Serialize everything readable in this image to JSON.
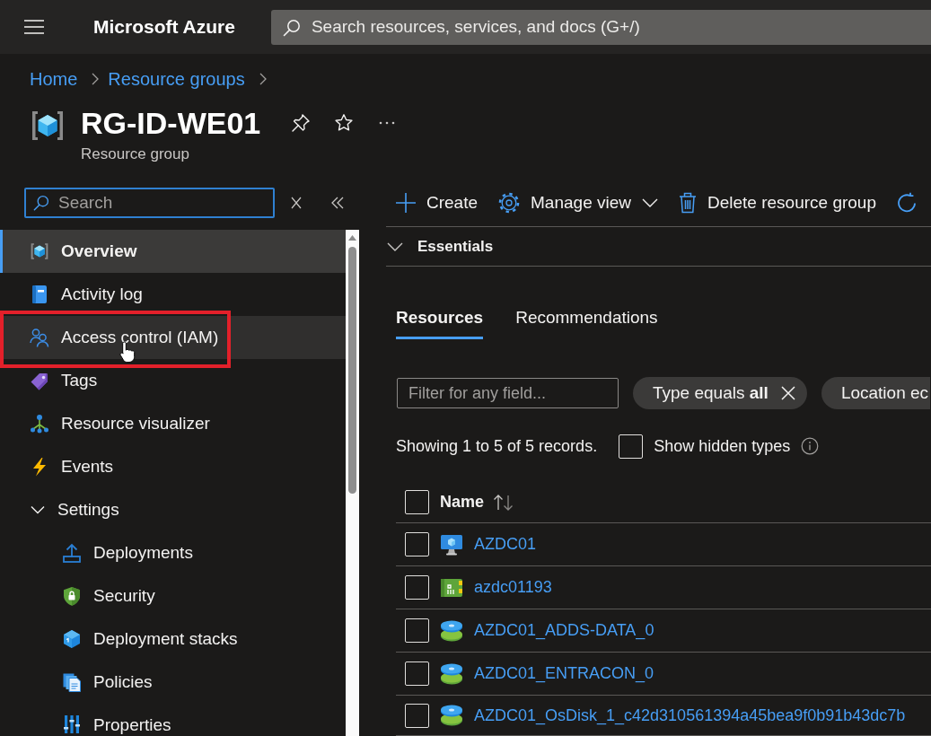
{
  "top_bar": {
    "brand": "Microsoft Azure",
    "search": {
      "placeholder": "Search resources, services, and docs (G+/)"
    }
  },
  "breadcrumb": [
    {
      "label": "Home"
    },
    {
      "label": "Resource groups"
    }
  ],
  "header": {
    "title": "RG-ID-WE01",
    "subtitle": "Resource group"
  },
  "sidebar": {
    "search": {
      "placeholder": "Search",
      "focused": true
    },
    "items": [
      {
        "label": "Overview",
        "selected": true,
        "hovered": false
      },
      {
        "label": "Activity log",
        "selected": false,
        "hovered": false
      },
      {
        "label": "Access control (IAM)",
        "selected": false,
        "hovered": true,
        "outlined": true
      },
      {
        "label": "Tags",
        "selected": false,
        "hovered": false
      },
      {
        "label": "Resource visualizer",
        "selected": false,
        "hovered": false
      },
      {
        "label": "Events",
        "selected": false,
        "hovered": false
      },
      {
        "label": "Settings",
        "selected": false,
        "hovered": false,
        "expanded": true,
        "children": [
          {
            "label": "Deployments",
            "selected": false
          },
          {
            "label": "Security",
            "selected": false
          },
          {
            "label": "Deployment stacks",
            "selected": false
          },
          {
            "label": "Policies",
            "selected": false
          },
          {
            "label": "Properties",
            "selected": false
          }
        ]
      }
    ]
  },
  "toolbar": [
    {
      "label": "Create",
      "dropdown": false
    },
    {
      "label": "Manage view",
      "dropdown": true
    },
    {
      "label": "Delete resource group",
      "dropdown": false
    }
  ],
  "essentials": {
    "label": "Essentials",
    "expanded": false
  },
  "tabs": [
    {
      "label": "Resources",
      "selected": true
    },
    {
      "label": "Recommendations",
      "selected": false
    }
  ],
  "filter": {
    "placeholder": "Filter for any field...",
    "pills": [
      {
        "text": "Type equals **all**",
        "removable": true
      },
      {
        "text": "Location ec",
        "removable": false
      }
    ]
  },
  "records": {
    "summary": "Showing 1 to 5 of 5 records.",
    "show_hidden": {
      "label": "Show hidden types",
      "checked": false
    }
  },
  "table": {
    "select_all": {
      "checked": false
    },
    "columns": [
      {
        "label": "Name",
        "sortable": true
      }
    ],
    "rows": [
      {
        "name": "AZDC01",
        "kind": "vm",
        "checked": false
      },
      {
        "name": "azdc01193",
        "kind": "nic",
        "checked": false
      },
      {
        "name": "AZDC01_ADDS-DATA_0",
        "kind": "disk",
        "checked": false
      },
      {
        "name": "AZDC01_ENTRACON_0",
        "kind": "disk",
        "checked": false
      },
      {
        "name": "AZDC01_OsDisk_1_c42d310561394a45bea9f0b91b43dc7b",
        "kind": "disk",
        "checked": false
      }
    ]
  }
}
